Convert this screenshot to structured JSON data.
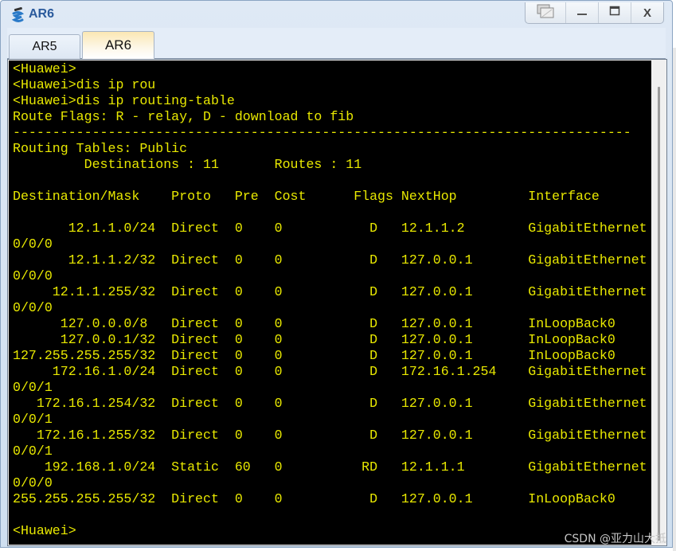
{
  "window": {
    "title": "AR6",
    "icon": "router-icon",
    "controls": {
      "restore_label": "",
      "minimize_label": "_",
      "maximize_label": "",
      "close_label": "X"
    }
  },
  "tabs": [
    {
      "label": "AR5",
      "active": false
    },
    {
      "label": "AR6",
      "active": true
    }
  ],
  "terminal": {
    "colors": {
      "background": "#000000",
      "text": "#e8e800"
    },
    "lines": [
      "<Huawei>",
      "<Huawei>dis ip rou",
      "<Huawei>dis ip routing-table",
      "Route Flags: R - relay, D - download to fib",
      "------------------------------------------------------------------------------",
      "Routing Tables: Public",
      "         Destinations : 11       Routes : 11",
      "",
      "Destination/Mask    Proto   Pre  Cost      Flags NextHop         Interface",
      "",
      "       12.1.1.0/24  Direct  0    0           D   12.1.1.2        GigabitEthernet",
      "0/0/0",
      "       12.1.1.2/32  Direct  0    0           D   127.0.0.1       GigabitEthernet",
      "0/0/0",
      "     12.1.1.255/32  Direct  0    0           D   127.0.0.1       GigabitEthernet",
      "0/0/0",
      "      127.0.0.0/8   Direct  0    0           D   127.0.0.1       InLoopBack0",
      "      127.0.0.1/32  Direct  0    0           D   127.0.0.1       InLoopBack0",
      "127.255.255.255/32  Direct  0    0           D   127.0.0.1       InLoopBack0",
      "     172.16.1.0/24  Direct  0    0           D   172.16.1.254    GigabitEthernet",
      "0/0/1",
      "   172.16.1.254/32  Direct  0    0           D   127.0.0.1       GigabitEthernet",
      "0/0/1",
      "   172.16.1.255/32  Direct  0    0           D   127.0.0.1       GigabitEthernet",
      "0/0/1",
      "    192.168.1.0/24  Static  60   0          RD   12.1.1.1        GigabitEthernet",
      "0/0/0",
      "255.255.255.255/32  Direct  0    0           D   127.0.0.1       InLoopBack0",
      "",
      "<Huawei>"
    ],
    "routing_table": {
      "prompt": "<Huawei>",
      "route_flags": "R - relay, D - download to fib",
      "table_name": "Public",
      "destinations": 11,
      "routes": 11,
      "columns": [
        "Destination/Mask",
        "Proto",
        "Pre",
        "Cost",
        "Flags",
        "NextHop",
        "Interface"
      ],
      "rows": [
        [
          "12.1.1.0/24",
          "Direct",
          "0",
          "0",
          "D",
          "12.1.1.2",
          "GigabitEthernet0/0/0"
        ],
        [
          "12.1.1.2/32",
          "Direct",
          "0",
          "0",
          "D",
          "127.0.0.1",
          "GigabitEthernet0/0/0"
        ],
        [
          "12.1.1.255/32",
          "Direct",
          "0",
          "0",
          "D",
          "127.0.0.1",
          "GigabitEthernet0/0/0"
        ],
        [
          "127.0.0.0/8",
          "Direct",
          "0",
          "0",
          "D",
          "127.0.0.1",
          "InLoopBack0"
        ],
        [
          "127.0.0.1/32",
          "Direct",
          "0",
          "0",
          "D",
          "127.0.0.1",
          "InLoopBack0"
        ],
        [
          "127.255.255.255/32",
          "Direct",
          "0",
          "0",
          "D",
          "127.0.0.1",
          "InLoopBack0"
        ],
        [
          "172.16.1.0/24",
          "Direct",
          "0",
          "0",
          "D",
          "172.16.1.254",
          "GigabitEthernet0/0/1"
        ],
        [
          "172.16.1.254/32",
          "Direct",
          "0",
          "0",
          "D",
          "127.0.0.1",
          "GigabitEthernet0/0/1"
        ],
        [
          "172.16.1.255/32",
          "Direct",
          "0",
          "0",
          "D",
          "127.0.0.1",
          "GigabitEthernet0/0/1"
        ],
        [
          "192.168.1.0/24",
          "Static",
          "60",
          "0",
          "RD",
          "12.1.1.1",
          "GigabitEthernet0/0/0"
        ],
        [
          "255.255.255.255/32",
          "Direct",
          "0",
          "0",
          "D",
          "127.0.0.1",
          "InLoopBack0"
        ]
      ]
    }
  },
  "watermark": "CSDN @亚力山大抵"
}
